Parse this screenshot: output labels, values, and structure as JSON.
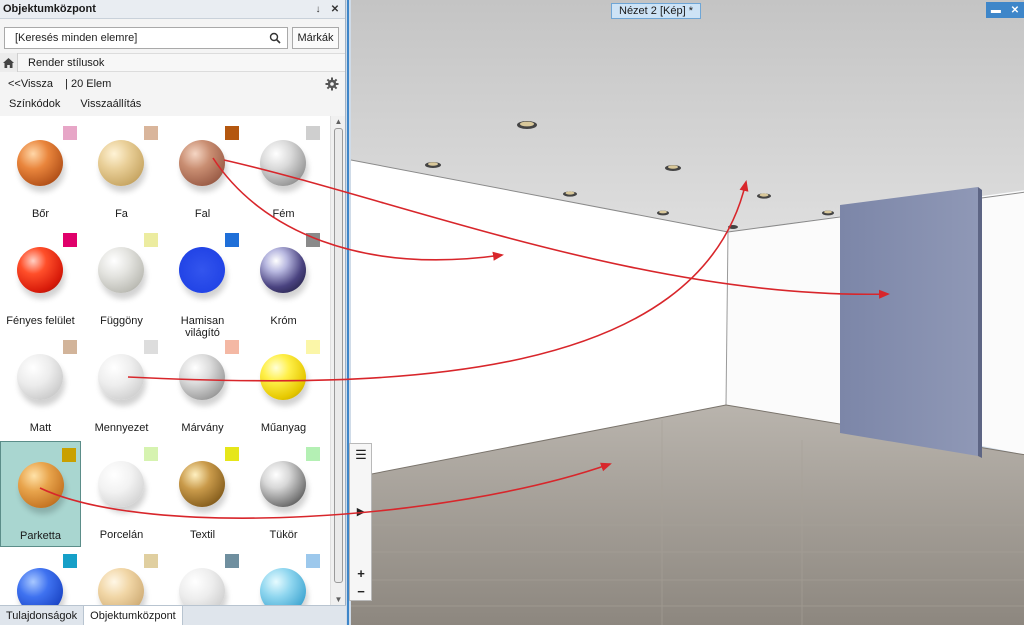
{
  "panel": {
    "title": "Objektumközpont",
    "pin_glyph": "↓",
    "close_glyph": "✕",
    "search_placeholder": "[Keresés minden elemre]",
    "brands_label": "Márkák",
    "breadcrumb": "Render stílusok",
    "back_label": "<<Vissza",
    "count_label": "| 20 Elem",
    "color_codes_label": "Színkódok",
    "reset_label": "Visszaállítás"
  },
  "materials": [
    {
      "label": "Bőr",
      "swatch": "#e7a6c7",
      "sphere": "radial-gradient(circle at 35% 30%, #ffd7a8 0%, #e9853c 35%, #b5531a 75%, #7a3210 100%)"
    },
    {
      "label": "Fa",
      "swatch": "#d9b59b",
      "sphere": "radial-gradient(circle at 35% 30%, #fff3d6 0%, #e9cf98 35%, #c9a866 75%, #8f7240 100%)"
    },
    {
      "label": "Fal",
      "swatch": "#b4570f",
      "sphere": "radial-gradient(circle at 35% 30%, #f5d6c4 0%, #c98e72 35%, #9d5f49 75%, #6a3b2b 100%)"
    },
    {
      "label": "Fém",
      "swatch": "#cfcfcf",
      "sphere": "radial-gradient(circle at 35% 30%, #ffffff 0%, #d9d9d9 35%, #9a9a9a 75%, #5a5a5a 100%)"
    },
    {
      "label": "Fényes felület",
      "swatch": "#e0006b",
      "sphere": "radial-gradient(circle at 35% 30%, #ffd0c4 0%, #ff4f2a 30%, #d81b0a 70%, #8a0a00 100%)"
    },
    {
      "label": "Függöny",
      "swatch": "#ececa0",
      "sphere": "radial-gradient(circle at 35% 30%, #ffffff 0%, #e4e4e0 35%, #bdbdb6 75%, #808079 100%)"
    },
    {
      "label": "Hamisan világító",
      "swatch": "#1f6fd8",
      "sphere": "radial-gradient(circle at 50% 50%, #3355ee 0%, #2244e6 70%, #1a36c4 100%)"
    },
    {
      "label": "Króm",
      "swatch": "#8a8a8a",
      "sphere": "radial-gradient(circle at 35% 30%, #ffffff 0%, #b8b8e0 25%, #4a4380 60%, #14122e 100%)"
    },
    {
      "label": "Matt",
      "swatch": "#d2b49a",
      "sphere": "radial-gradient(circle at 35% 30%, #ffffff 0%, #ececec 40%, #c9c9c9 80%, #9a9a9a 100%)"
    },
    {
      "label": "Mennyezet",
      "swatch": "#dddddd",
      "sphere": "radial-gradient(circle at 35% 30%, #ffffff 0%, #eeeeee 40%, #cfcfcf 80%, #a0a0a0 100%)"
    },
    {
      "label": "Márvány",
      "swatch": "#f4b8a4",
      "sphere": "radial-gradient(circle at 35% 30%, #ffffff 0%, #dcdcdc 35%, #9e9e9e 75%, #5a5a5a 100%)"
    },
    {
      "label": "Műanyag",
      "swatch": "#fbf6a8",
      "sphere": "radial-gradient(circle at 35% 30%, #ffffd8 0%, #fff04a 30%, #e6c800 70%, #a88f00 100%)"
    },
    {
      "label": "Parketta",
      "swatch": "#c9a000",
      "sphere": "radial-gradient(circle at 35% 30%, #ffe2a8 0%, #e8a44c 35%, #c57523 75%, #7e4612 100%)"
    },
    {
      "label": "Porcelán",
      "swatch": "#d6f3b0",
      "sphere": "radial-gradient(circle at 35% 30%, #ffffff 0%, #f2f2f2 40%, #d4d4d4 80%, #a4a4a4 100%)"
    },
    {
      "label": "Textil",
      "swatch": "#e6e61a",
      "sphere": "radial-gradient(circle at 35% 30%, #fff0c0 0%, #c99a4a 35%, #8a6220 75%, #4a3008 100%)"
    },
    {
      "label": "Tükör",
      "swatch": "#b4f0b4",
      "sphere": "radial-gradient(circle at 35% 30%, #ffffff 0%, #d8d8d8 30%, #7a7a7a 70%, #2a2a2a 100%)"
    },
    {
      "label": "",
      "swatch": "#16a0c8",
      "sphere": "radial-gradient(circle at 35% 30%, #a8c8ff 0%, #3f72f0 35%, #1d48c8 75%, #0c2680 100%)"
    },
    {
      "label": "",
      "swatch": "#e0cfa0",
      "sphere": "radial-gradient(circle at 35% 30%, #fff7e6 0%, #f1d6a6 35%, #d2b07a 75%, #9c7c4c 100%)"
    },
    {
      "label": "",
      "swatch": "#6f8f9f",
      "sphere": "radial-gradient(circle at 35% 30%, #ffffff 0%, #ededed 40%, #cfcfcf 80%, #9d9d9d 100%)"
    },
    {
      "label": "",
      "swatch": "#9cc8ec",
      "sphere": "radial-gradient(circle at 35% 30%, #e6fbff 0%, #8fd6ef 35%, #46a9d3 75%, #1c6b93 100%)"
    }
  ],
  "selected_index": 12,
  "tabs": [
    {
      "label": "Tulajdonságok"
    },
    {
      "label": "Objektumközpont"
    }
  ],
  "viewport": {
    "tab_label": "Nézet 2 [Kép] *",
    "minimize_glyph": "▬",
    "close_glyph": "✕"
  },
  "toolstrip": {
    "list_glyph": "☰",
    "play_glyph": "▶",
    "plus_glyph": "+",
    "minus_glyph": "−"
  },
  "colors": {
    "accent": "#3e86c9",
    "selected_bg": "#a9d6d0",
    "arrow": "#d8262b"
  }
}
